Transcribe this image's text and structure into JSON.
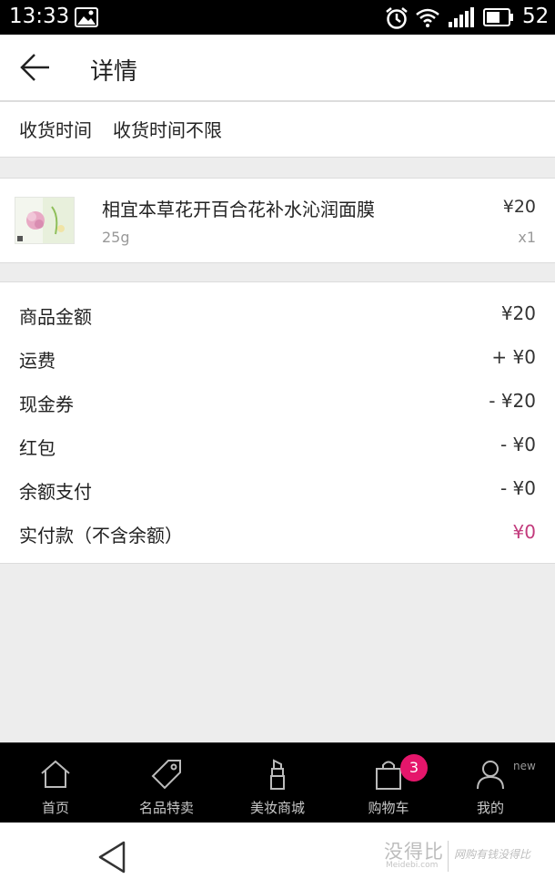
{
  "status_bar": {
    "time": "13:33",
    "battery": "52",
    "icons": [
      "image-icon",
      "alarm-icon",
      "wifi-icon",
      "signal-icon",
      "battery-icon"
    ]
  },
  "header": {
    "back_icon": "arrow-left-icon",
    "title": "详情"
  },
  "delivery": {
    "label": "收货时间",
    "value": "收货时间不限"
  },
  "product": {
    "name": "相宜本草花开百合花补水沁润面膜",
    "spec": "25g",
    "price": "¥20",
    "quantity": "x1"
  },
  "summary": [
    {
      "label": "商品金额",
      "value": "¥20"
    },
    {
      "label": "运费",
      "value": "+ ¥0"
    },
    {
      "label": "现金券",
      "value": "- ¥20"
    },
    {
      "label": "红包",
      "value": "- ¥0"
    },
    {
      "label": "余额支付",
      "value": "- ¥0"
    },
    {
      "label": "实付款（不含余额）",
      "value": "¥0"
    }
  ],
  "tabs": [
    {
      "label": "首页",
      "icon": "home-icon"
    },
    {
      "label": "名品特卖",
      "icon": "tag-icon"
    },
    {
      "label": "美妆商城",
      "icon": "lipstick-icon"
    },
    {
      "label": "购物车",
      "icon": "shopping-bag-icon",
      "badge": "3"
    },
    {
      "label": "我的",
      "icon": "user-icon",
      "tag": "new"
    }
  ],
  "watermark": {
    "brand": "没得比",
    "domain": "Meidebi.com",
    "slogan": "网购有钱没得比"
  },
  "colors": {
    "accent_pink": "#e5166b",
    "paid_amount": "#c23a7c",
    "tab_bar_bg": "#000000"
  }
}
